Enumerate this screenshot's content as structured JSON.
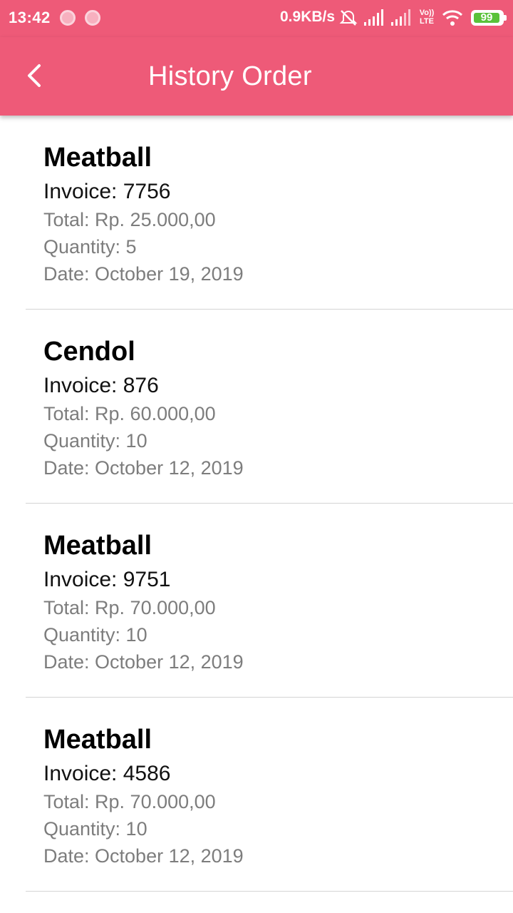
{
  "status_bar": {
    "time": "13:42",
    "network_speed": "0.9KB/s",
    "volte_label": "Vo)) LTE",
    "battery_level": "99",
    "icons": [
      "notification-dot-icon",
      "notification-dot-icon",
      "alarm-off-icon",
      "signal-icon",
      "signal-icon",
      "volte-icon",
      "wifi-icon",
      "battery-icon"
    ]
  },
  "app_bar": {
    "title": "History Order",
    "back_icon": "back-arrow-icon",
    "color": "#ee5a78"
  },
  "orders": [
    {
      "name": "Meatball",
      "invoice": "Invoice: 7756",
      "total": "Total: Rp. 25.000,00",
      "quantity": "Quantity: 5",
      "date": "Date: October 19, 2019"
    },
    {
      "name": "Cendol",
      "invoice": "Invoice: 876",
      "total": "Total: Rp. 60.000,00",
      "quantity": "Quantity: 10",
      "date": "Date: October 12, 2019"
    },
    {
      "name": "Meatball",
      "invoice": "Invoice: 9751",
      "total": "Total: Rp. 70.000,00",
      "quantity": "Quantity: 10",
      "date": "Date: October 12, 2019"
    },
    {
      "name": "Meatball",
      "invoice": "Invoice: 4586",
      "total": "Total: Rp. 70.000,00",
      "quantity": "Quantity: 10",
      "date": "Date: October 12, 2019"
    }
  ]
}
